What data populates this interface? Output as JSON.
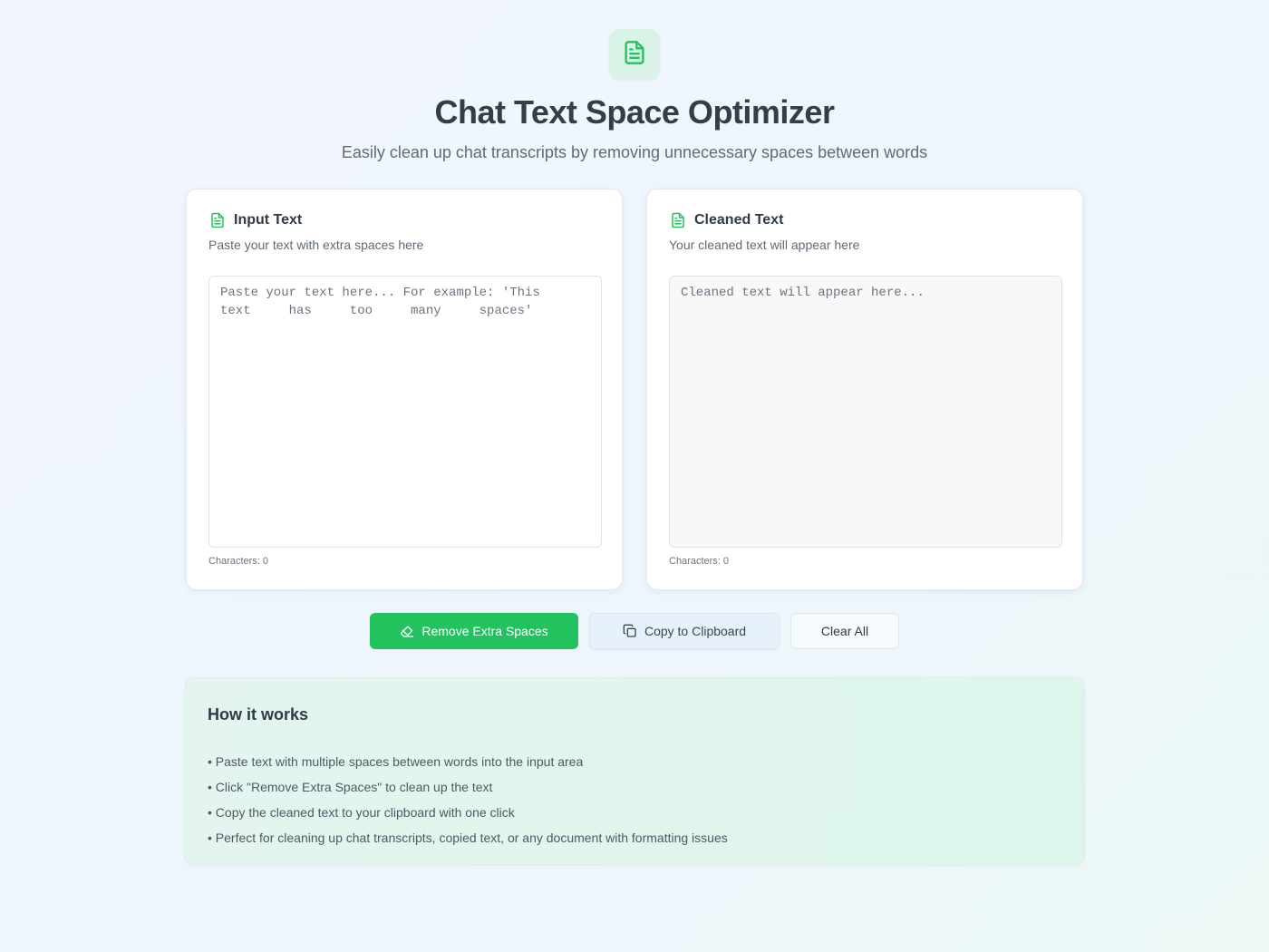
{
  "header": {
    "title": "Chat Text Space Optimizer",
    "subtitle": "Easily clean up chat transcripts by removing unnecessary spaces between words",
    "logo_icon": "document-icon"
  },
  "input_panel": {
    "title": "Input Text",
    "description": "Paste your text with extra spaces here",
    "placeholder": "Paste your text here... For example: 'This     text     has     too     many     spaces'",
    "value": "",
    "char_count": "Characters: 0",
    "icon": "document-icon"
  },
  "output_panel": {
    "title": "Cleaned Text",
    "description": "Your cleaned text will appear here",
    "placeholder": "Cleaned text will appear here...",
    "value": "",
    "char_count": "Characters: 0",
    "icon": "document-icon"
  },
  "actions": {
    "remove_label": "Remove Extra Spaces",
    "copy_label": "Copy to Clipboard",
    "clear_label": "Clear All",
    "remove_icon": "eraser-icon",
    "copy_icon": "copy-icon"
  },
  "how_it_works": {
    "title": "How it works",
    "items": [
      "• Paste text with multiple spaces between words into the input area",
      "• Click \"Remove Extra Spaces\" to clean up the text",
      "• Copy the cleaned text to your clipboard with one click",
      "• Perfect for cleaning up chat transcripts, copied text, or any document with formatting issues"
    ]
  },
  "colors": {
    "accent": "#22c35e",
    "background": "#eef6fd",
    "info_background": "#e0f6ec"
  }
}
